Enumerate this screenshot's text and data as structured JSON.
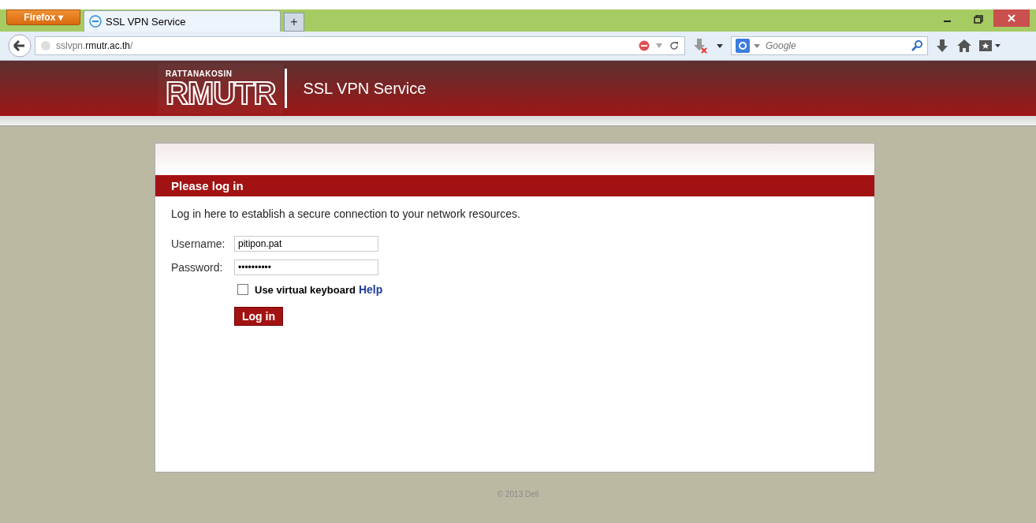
{
  "browser": {
    "menu_button": "Firefox ▾",
    "tabs": [
      {
        "label": "SSL VPN Service",
        "selected": true
      }
    ],
    "new_tab": "+",
    "url_host_prefix": "sslvpn.",
    "url_domain": "rmutr.ac.th",
    "url_suffix": "/",
    "search": {
      "placeholder": "Google"
    }
  },
  "header": {
    "logo_small": "RATTANAKOSIN",
    "logo_big": "RMUTR",
    "title": "SSL VPN Service"
  },
  "login": {
    "heading": "Please log in",
    "intro": "Log in here to establish a secure connection to your network resources.",
    "fields": [
      {
        "label": "Username:",
        "value": "pitipon.pat"
      },
      {
        "label": "Password:",
        "value": "••••••••••"
      }
    ],
    "virtual_keyboard": {
      "label": "Use virtual keyboard",
      "checked": false
    },
    "help": "Help",
    "button": "Log in"
  },
  "footer": "© 2013 Dell"
}
